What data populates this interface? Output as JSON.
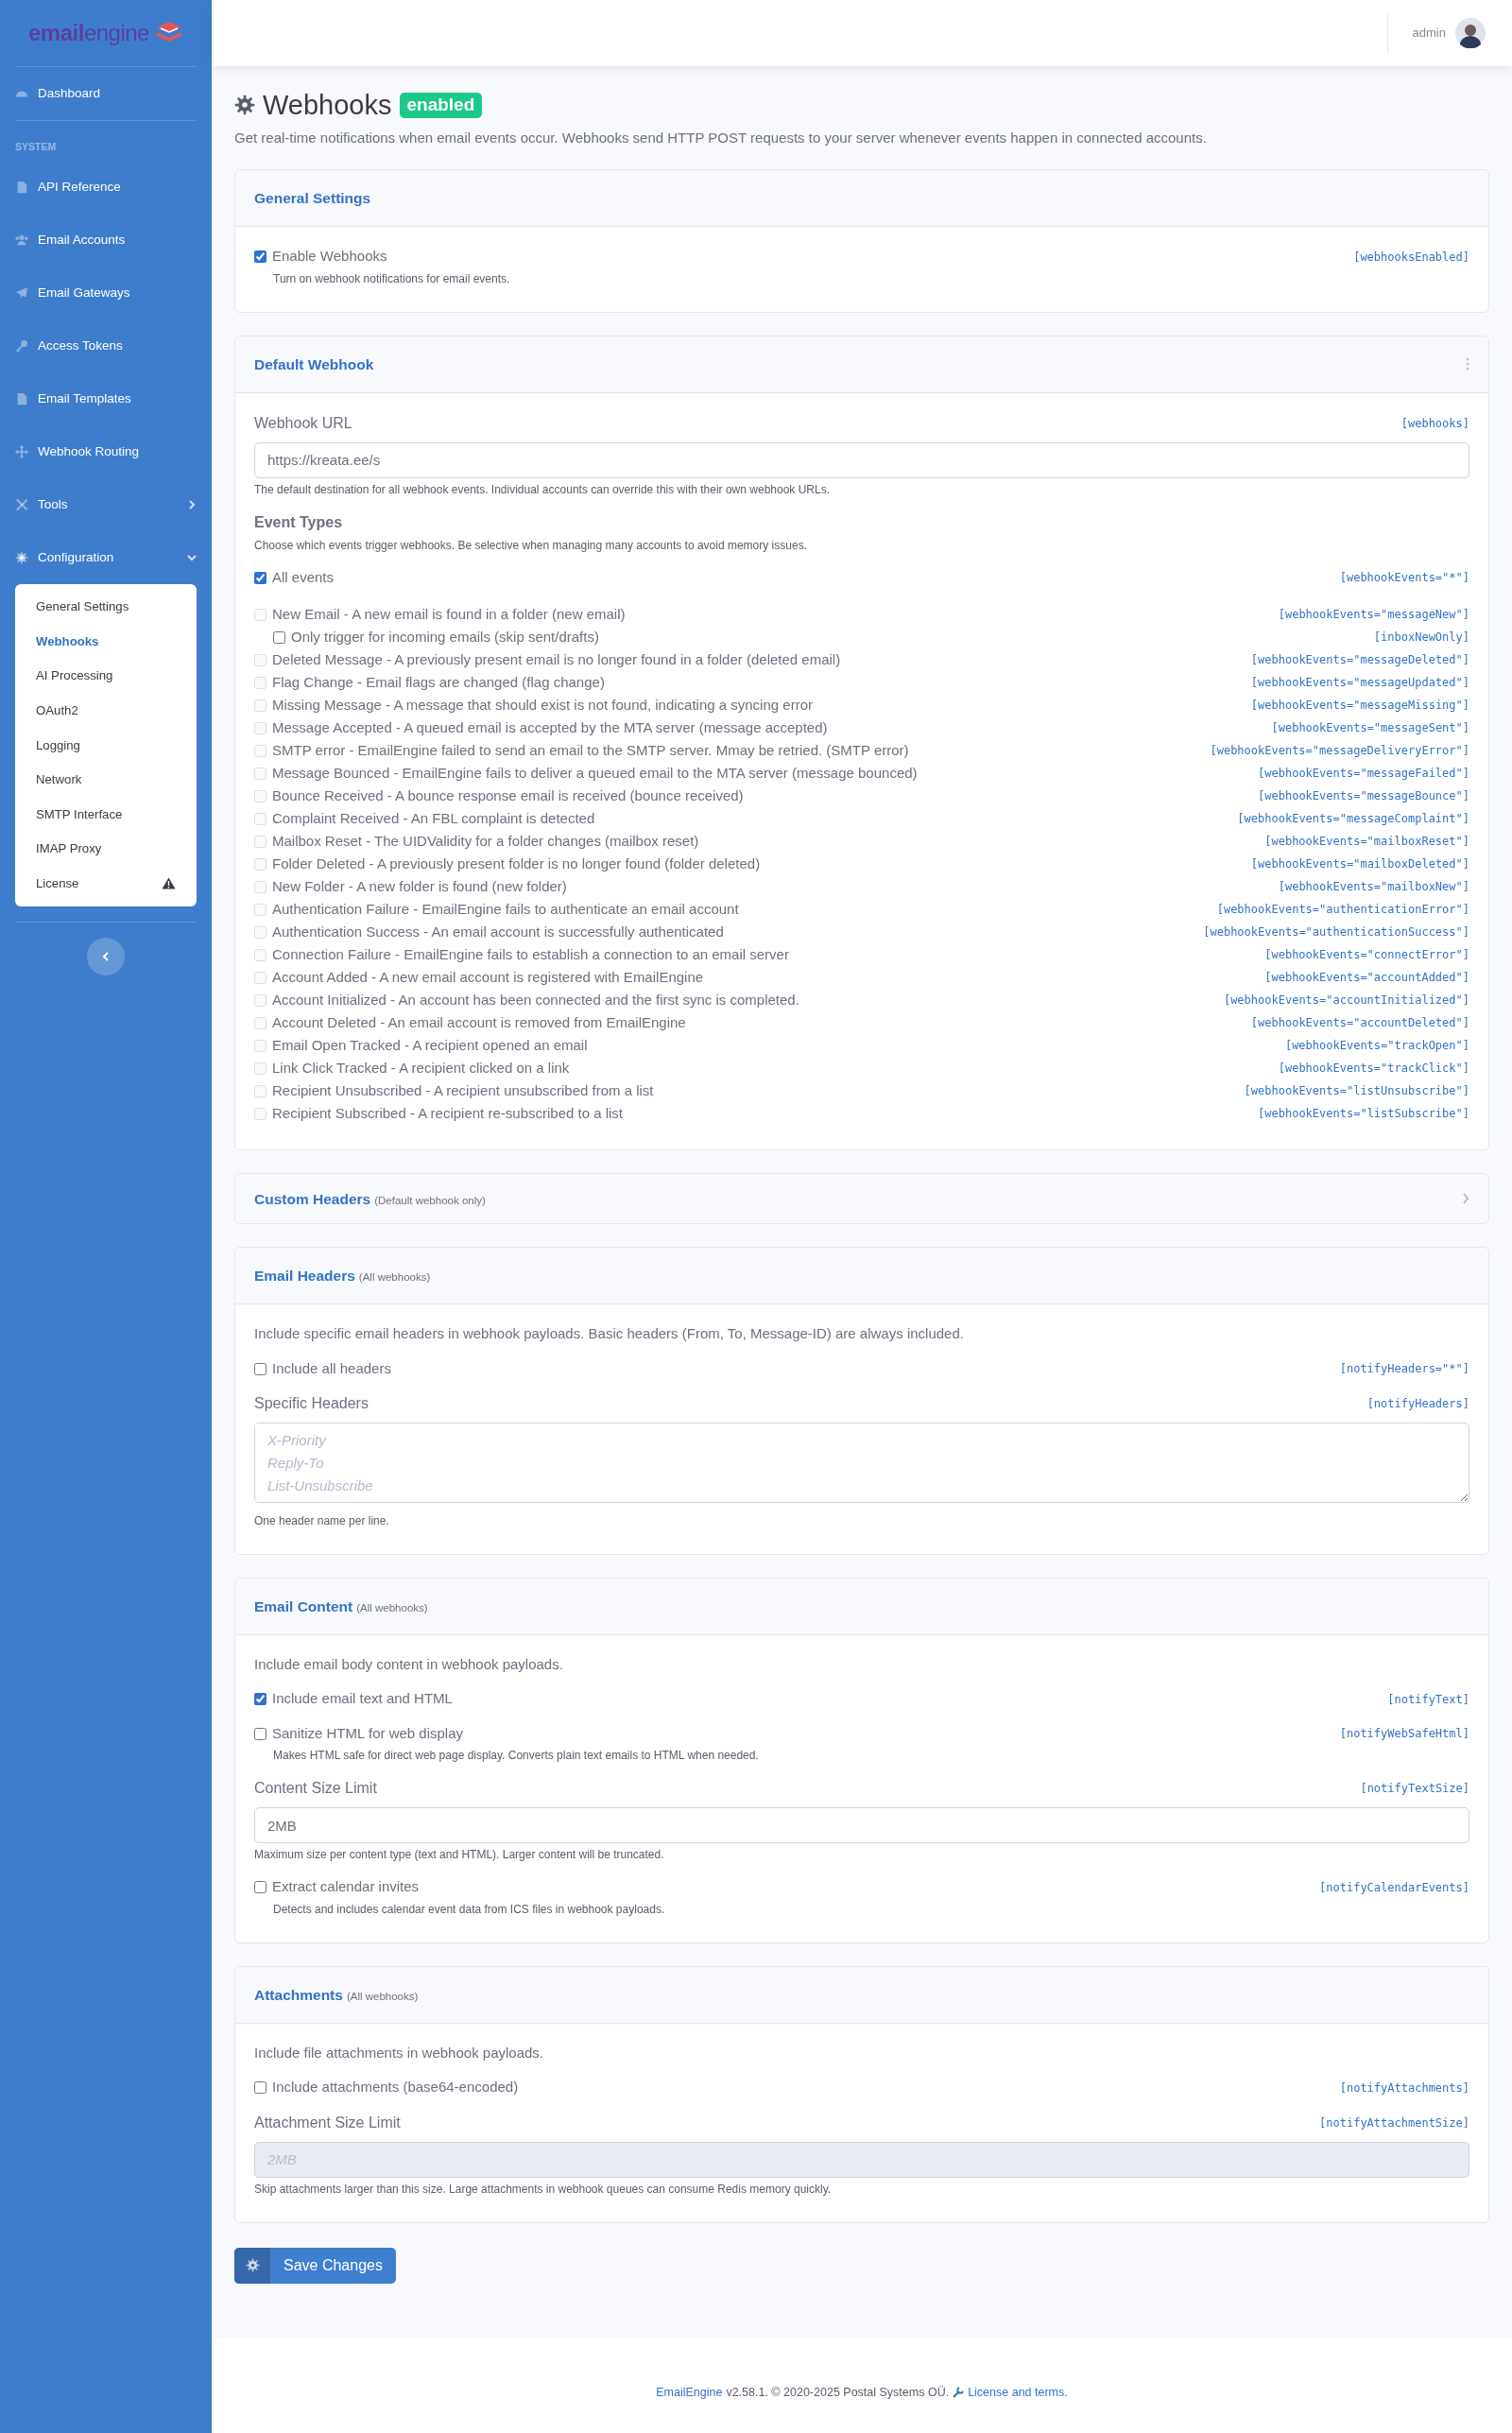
{
  "sidebar": {
    "logo": "**email**engine",
    "top_items": [
      {
        "label": "Dashboard"
      }
    ],
    "section_label": "SYSTEM",
    "items": [
      {
        "kind": "link",
        "label": "API Reference"
      },
      {
        "kind": "link",
        "label": "Email Accounts"
      },
      {
        "kind": "link",
        "label": "Email Gateways"
      },
      {
        "kind": "link",
        "label": "Access Tokens"
      },
      {
        "kind": "link",
        "label": "Email Templates"
      },
      {
        "kind": "link",
        "label": "Webhook Routing"
      },
      {
        "kind": "group",
        "label": "Tools",
        "expanded": false
      },
      {
        "kind": "group",
        "label": "Configuration",
        "expanded": true,
        "children": [
          {
            "label": "General Settings",
            "selected": false,
            "warning": false
          },
          {
            "label": "Webhooks",
            "selected": true,
            "warning": false
          },
          {
            "label": "AI Processing",
            "selected": false,
            "warning": false
          },
          {
            "label": "OAuth2",
            "selected": false,
            "warning": false
          },
          {
            "label": "Logging",
            "selected": false,
            "warning": false
          },
          {
            "label": "Network",
            "selected": false,
            "warning": false
          },
          {
            "label": "SMTP Interface",
            "selected": false,
            "warning": false
          },
          {
            "label": "IMAP Proxy",
            "selected": false,
            "warning": false
          },
          {
            "label": "License",
            "selected": false,
            "warning": true
          }
        ]
      }
    ]
  },
  "topbar": {
    "user": "admin"
  },
  "page": {
    "title": "Webhooks",
    "badge": "enabled",
    "description": "Get real-time notifications when email events occur. Webhooks send HTTP POST requests to your server whenever events happen in connected accounts."
  },
  "cards": [
    {
      "title": "General Settings",
      "items": [
        {
          "kind": "checkbox",
          "label": "Enable Webhooks",
          "tag": "[webhooksEnabled]",
          "checked": true,
          "help": "Turn on webhook notifications for email events."
        }
      ]
    },
    {
      "title": "Default Webhook",
      "menu": true,
      "items": [
        {
          "kind": "input",
          "label": "Webhook URL",
          "tag": "[webhooks]",
          "value": "https://kreata.ee/s",
          "disabled": false,
          "help": "The default destination for all webhook events. Individual accounts can override this with their own webhook URLs."
        },
        {
          "kind": "heading",
          "label": "Event Types",
          "help": "Choose which events trigger webhooks. Be selective when managing many accounts to avoid memory issues."
        },
        {
          "kind": "checkbox",
          "label": "All events",
          "tag": "[webhookEvents=\"*\"]",
          "checked": true
        },
        {
          "kind": "events",
          "events": [
            {
              "label": "New Email - A new email is found in a folder (new email)",
              "tag": "[webhookEvents=\"messageNew\"]",
              "checked": false,
              "disabled": true,
              "children": [
                {
                  "label": "Only trigger for incoming emails (skip sent/drafts)",
                  "tag": "[inboxNewOnly]",
                  "checked": false,
                  "disabled": false
                }
              ]
            },
            {
              "label": "Deleted Message - A previously present email is no longer found in a folder (deleted email)",
              "tag": "[webhookEvents=\"messageDeleted\"]",
              "checked": false,
              "disabled": true
            },
            {
              "label": "Flag Change - Email flags are changed (flag change)",
              "tag": "[webhookEvents=\"messageUpdated\"]",
              "checked": false,
              "disabled": true
            },
            {
              "label": "Missing Message - A message that should exist is not found, indicating a syncing error",
              "tag": "[webhookEvents=\"messageMissing\"]",
              "checked": false,
              "disabled": true
            },
            {
              "label": "Message Accepted - A queued email is accepted by the MTA server (message accepted)",
              "tag": "[webhookEvents=\"messageSent\"]",
              "checked": false,
              "disabled": true
            },
            {
              "label": "SMTP error - EmailEngine failed to send an email to the SMTP server. Mmay be retried. (SMTP error)",
              "tag": "[webhookEvents=\"messageDeliveryError\"]",
              "checked": false,
              "disabled": true
            },
            {
              "label": "Message Bounced - EmailEngine fails to deliver a queued email to the MTA server (message bounced)",
              "tag": "[webhookEvents=\"messageFailed\"]",
              "checked": false,
              "disabled": true
            },
            {
              "label": "Bounce Received - A bounce response email is received (bounce received)",
              "tag": "[webhookEvents=\"messageBounce\"]",
              "checked": false,
              "disabled": true
            },
            {
              "label": "Complaint Received - An FBL complaint is detected",
              "tag": "[webhookEvents=\"messageComplaint\"]",
              "checked": false,
              "disabled": true
            },
            {
              "label": "Mailbox Reset - The UIDValidity for a folder changes (mailbox reset)",
              "tag": "[webhookEvents=\"mailboxReset\"]",
              "checked": false,
              "disabled": true
            },
            {
              "label": "Folder Deleted - A previously present folder is no longer found (folder deleted)",
              "tag": "[webhookEvents=\"mailboxDeleted\"]",
              "checked": false,
              "disabled": true
            },
            {
              "label": "New Folder - A new folder is found (new folder)",
              "tag": "[webhookEvents=\"mailboxNew\"]",
              "checked": false,
              "disabled": true
            },
            {
              "label": "Authentication Failure - EmailEngine fails to authenticate an email account",
              "tag": "[webhookEvents=\"authenticationError\"]",
              "checked": false,
              "disabled": true
            },
            {
              "label": "Authentication Success - An email account is successfully authenticated",
              "tag": "[webhookEvents=\"authenticationSuccess\"]",
              "checked": false,
              "disabled": true
            },
            {
              "label": "Connection Failure - EmailEngine fails to establish a connection to an email server",
              "tag": "[webhookEvents=\"connectError\"]",
              "checked": false,
              "disabled": true
            },
            {
              "label": "Account Added - A new email account is registered with EmailEngine",
              "tag": "[webhookEvents=\"accountAdded\"]",
              "checked": false,
              "disabled": true
            },
            {
              "label": "Account Initialized - An account has been connected and the first sync is completed.",
              "tag": "[webhookEvents=\"accountInitialized\"]",
              "checked": false,
              "disabled": true
            },
            {
              "label": "Account Deleted - An email account is removed from EmailEngine",
              "tag": "[webhookEvents=\"accountDeleted\"]",
              "checked": false,
              "disabled": true
            },
            {
              "label": "Email Open Tracked - A recipient opened an email",
              "tag": "[webhookEvents=\"trackOpen\"]",
              "checked": false,
              "disabled": true
            },
            {
              "label": "Link Click Tracked - A recipient clicked on a link",
              "tag": "[webhookEvents=\"trackClick\"]",
              "checked": false,
              "disabled": true
            },
            {
              "label": "Recipient Unsubscribed - A recipient unsubscribed from a list",
              "tag": "[webhookEvents=\"listUnsubscribe\"]",
              "checked": false,
              "disabled": true
            },
            {
              "label": "Recipient Subscribed - A recipient re-subscribed to a list",
              "tag": "[webhookEvents=\"listSubscribe\"]",
              "checked": false,
              "disabled": true
            }
          ]
        }
      ]
    },
    {
      "title": "Custom Headers",
      "subtitle": "(Default webhook only)",
      "expanded": false
    },
    {
      "title": "Email Headers",
      "subtitle": "(All webhooks)",
      "items": [
        {
          "kind": "text",
          "label": "Include specific email headers in webhook payloads. Basic headers (From, To, Message-ID) are always included."
        },
        {
          "kind": "checkbox",
          "label": "Include all headers",
          "tag": "[notifyHeaders=\"*\"]",
          "checked": false
        },
        {
          "kind": "textarea",
          "label": "Specific Headers",
          "tag": "[notifyHeaders]",
          "placeholder": "X-Priority\nReply-To\nList-Unsubscribe",
          "help": "One header name per line."
        }
      ]
    },
    {
      "title": "Email Content",
      "subtitle": "(All webhooks)",
      "items": [
        {
          "kind": "text",
          "label": "Include email body content in webhook payloads."
        },
        {
          "kind": "checkbox",
          "label": "Include email text and HTML",
          "tag": "[notifyText]",
          "checked": true
        },
        {
          "kind": "checkbox",
          "label": "Sanitize HTML for web display",
          "tag": "[notifyWebSafeHtml]",
          "checked": false,
          "help": "Makes HTML safe for direct web page display. Converts plain text emails to HTML when needed."
        },
        {
          "kind": "input",
          "label": "Content Size Limit",
          "tag": "[notifyTextSize]",
          "value": "2MB",
          "disabled": false,
          "help": "Maximum size per content type (text and HTML). Larger content will be truncated."
        },
        {
          "kind": "checkbox",
          "label": "Extract calendar invites",
          "tag": "[notifyCalendarEvents]",
          "checked": false,
          "help": "Detects and includes calendar event data from ICS files in webhook payloads."
        }
      ]
    },
    {
      "title": "Attachments",
      "subtitle": "(All webhooks)",
      "items": [
        {
          "kind": "text",
          "label": "Include file attachments in webhook payloads."
        },
        {
          "kind": "checkbox",
          "label": "Include attachments (base64-encoded)",
          "tag": "[notifyAttachments]",
          "checked": false
        },
        {
          "kind": "input",
          "label": "Attachment Size Limit",
          "tag": "[notifyAttachmentSize]",
          "placeholder": "2MB",
          "disabled": true,
          "help": "Skip attachments larger than this size. Large attachments in webhook queues can consume Redis memory quickly."
        }
      ]
    }
  ],
  "save_button": "Save Changes",
  "footer": {
    "product": "EmailEngine",
    "text": "v2.58.1. © 2020-2025 Postal Systems OÜ.",
    "license": "License and terms."
  }
}
